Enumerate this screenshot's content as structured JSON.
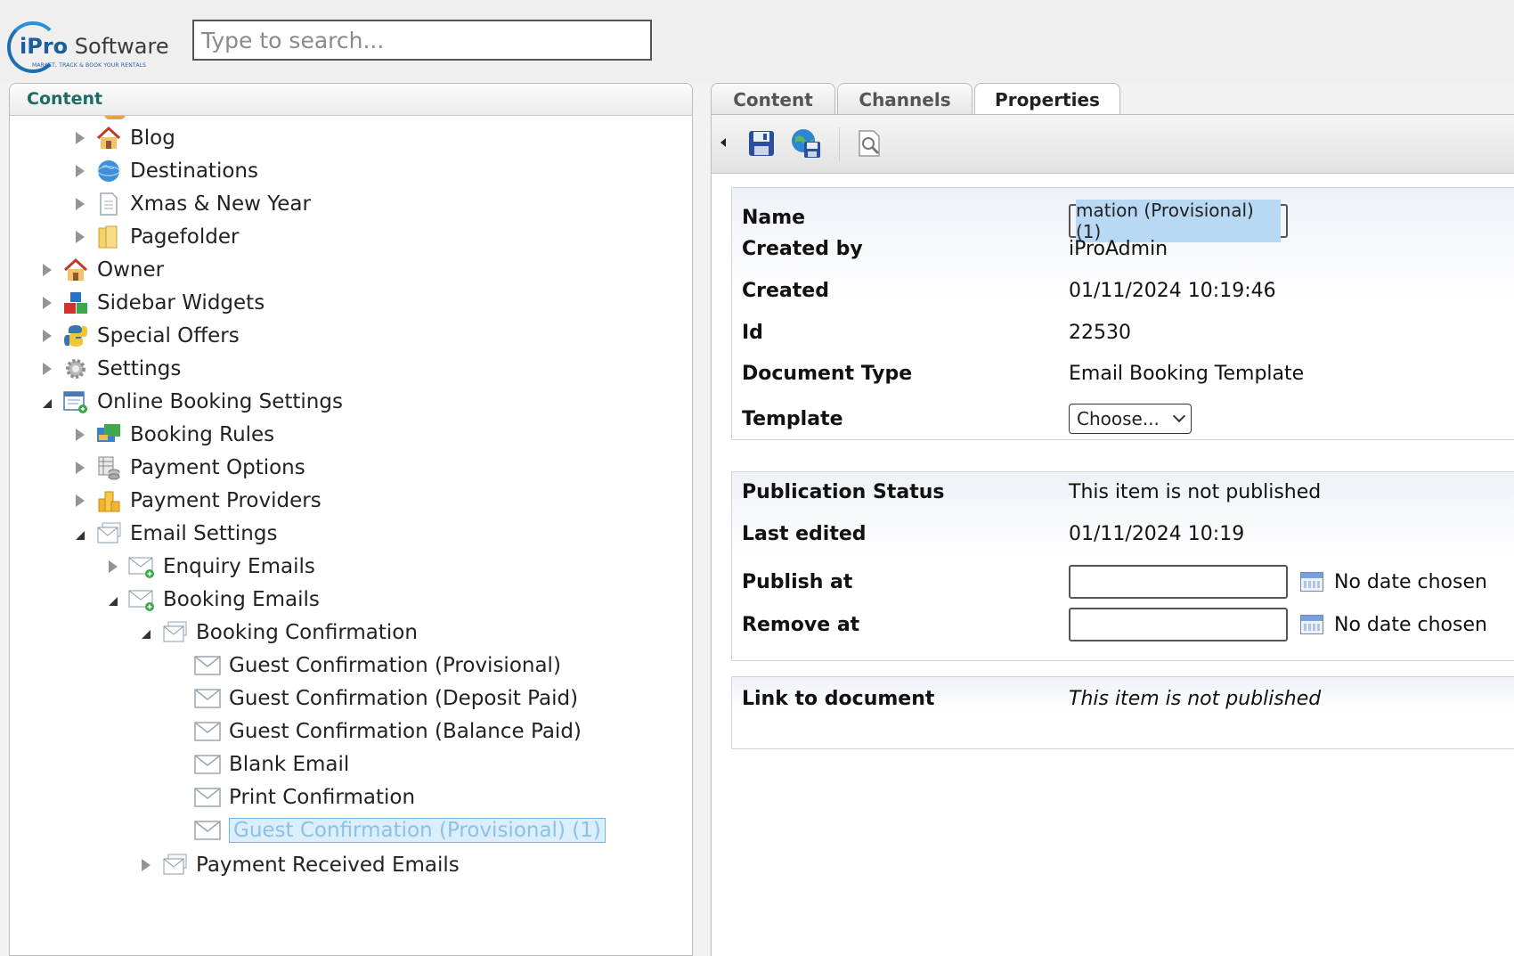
{
  "brand": {
    "name_bold": "iPro",
    "name_rest": "Software",
    "tagline": "MARKET, TRACK & BOOK YOUR RENTALS"
  },
  "search": {
    "placeholder": "Type to search...",
    "value": ""
  },
  "left_panel": {
    "title": "Content",
    "tree": [
      {
        "label": "Blog",
        "icon": "house-icon",
        "state": "closed",
        "level": 1
      },
      {
        "label": "Destinations",
        "icon": "globe-icon",
        "state": "closed",
        "level": 1
      },
      {
        "label": "Xmas & New Year",
        "icon": "document-icon",
        "state": "closed",
        "level": 1
      },
      {
        "label": "Pagefolder",
        "icon": "folder-icon",
        "state": "closed",
        "level": 1
      },
      {
        "label": "Owner",
        "icon": "house-icon",
        "state": "closed",
        "level": 0
      },
      {
        "label": "Sidebar Widgets",
        "icon": "blocks-icon",
        "state": "closed",
        "level": 0
      },
      {
        "label": "Special Offers",
        "icon": "python-icon",
        "state": "closed",
        "level": 0
      },
      {
        "label": "Settings",
        "icon": "gear-icon",
        "state": "closed",
        "level": 0
      },
      {
        "label": "Online Booking Settings",
        "icon": "booking-settings-icon",
        "state": "open",
        "level": 0
      },
      {
        "label": "Booking Rules",
        "icon": "booking-rules-icon",
        "state": "closed",
        "level": 1
      },
      {
        "label": "Payment Options",
        "icon": "database-icon",
        "state": "closed",
        "level": 1
      },
      {
        "label": "Payment Providers",
        "icon": "coins-icon",
        "state": "closed",
        "level": 1
      },
      {
        "label": "Email Settings",
        "icon": "email-stack-icon",
        "state": "open",
        "level": 1
      },
      {
        "label": "Enquiry Emails",
        "icon": "email-add-icon",
        "state": "closed",
        "level": 2
      },
      {
        "label": "Booking Emails",
        "icon": "email-add-icon",
        "state": "open",
        "level": 2
      },
      {
        "label": "Booking Confirmation",
        "icon": "email-stack-icon",
        "state": "open",
        "level": 3
      },
      {
        "label": "Guest Confirmation (Provisional)",
        "icon": "envelope-icon",
        "state": "none",
        "level": 4
      },
      {
        "label": "Guest Confirmation (Deposit Paid)",
        "icon": "envelope-icon",
        "state": "none",
        "level": 4
      },
      {
        "label": "Guest Confirmation (Balance Paid)",
        "icon": "envelope-icon",
        "state": "none",
        "level": 4
      },
      {
        "label": "Blank Email",
        "icon": "envelope-icon",
        "state": "none",
        "level": 4
      },
      {
        "label": "Print Confirmation",
        "icon": "envelope-icon",
        "state": "none",
        "level": 4
      },
      {
        "label": "Guest Confirmation (Provisional) (1)",
        "icon": "envelope-icon",
        "state": "none",
        "level": 4,
        "selected": true
      },
      {
        "label": "Payment Received Emails",
        "icon": "email-stack-icon",
        "state": "closed",
        "level": 3
      }
    ]
  },
  "tabs": [
    {
      "label": "Content",
      "active": false
    },
    {
      "label": "Channels",
      "active": false
    },
    {
      "label": "Properties",
      "active": true
    }
  ],
  "toolbar": {
    "buttons": [
      "save-icon",
      "save-and-publish-icon",
      "preview-icon"
    ]
  },
  "properties": {
    "name": {
      "label": "Name",
      "value": "mation (Provisional) (1)"
    },
    "created_by": {
      "label": "Created by",
      "value": "iProAdmin"
    },
    "created": {
      "label": "Created",
      "value": "01/11/2024 10:19:46"
    },
    "id": {
      "label": "Id",
      "value": "22530"
    },
    "document_type": {
      "label": "Document Type",
      "value": "Email Booking Template"
    },
    "template": {
      "label": "Template",
      "value": "Choose..."
    }
  },
  "publication": {
    "status": {
      "label": "Publication Status",
      "value": "This item is not published"
    },
    "last_edited": {
      "label": "Last edited",
      "value": "01/11/2024 10:19"
    },
    "publish_at": {
      "label": "Publish at",
      "value": "",
      "note": "No date chosen"
    },
    "remove_at": {
      "label": "Remove at",
      "value": "",
      "note": "No date chosen"
    }
  },
  "link": {
    "label": "Link to document",
    "value": "This item is not published"
  }
}
